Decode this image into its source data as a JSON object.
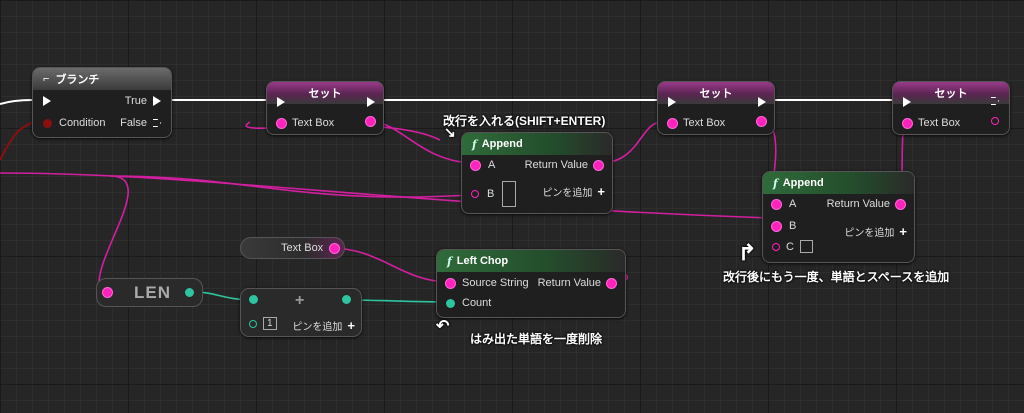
{
  "branch": {
    "title": "ブランチ",
    "condition": "Condition",
    "true_label": "True",
    "false_label": "False"
  },
  "set1": {
    "title": "セット",
    "pin": "Text Box"
  },
  "set2": {
    "title": "セット",
    "pin": "Text Box"
  },
  "set3": {
    "title": "セット",
    "pin": "Text Box"
  },
  "append1": {
    "title": "Append",
    "a": "A",
    "b": "B",
    "return_value": "Return Value",
    "add_pin": "ピンを追加"
  },
  "append2": {
    "title": "Append",
    "a": "A",
    "b": "B",
    "c": "C",
    "return_value": "Return Value",
    "add_pin": "ピンを追加"
  },
  "textbox_var": {
    "label": "Text Box"
  },
  "left_chop": {
    "title": "Left Chop",
    "source": "Source String",
    "count": "Count",
    "return_value": "Return Value"
  },
  "len": {
    "label": "LEN"
  },
  "add_node": {
    "num": "1",
    "add_pin": "ピンを追加"
  },
  "annotations": {
    "newline": "改行を入れる(SHIFT+ENTER)",
    "after_newline": "改行後にもう一度、単語とスペースを追加",
    "delete_word": "はみ出た単語を一度削除"
  },
  "colors": {
    "string_pin": "#ff22bb",
    "int_pin": "#2ec4a0",
    "exec": "#ffffff"
  }
}
